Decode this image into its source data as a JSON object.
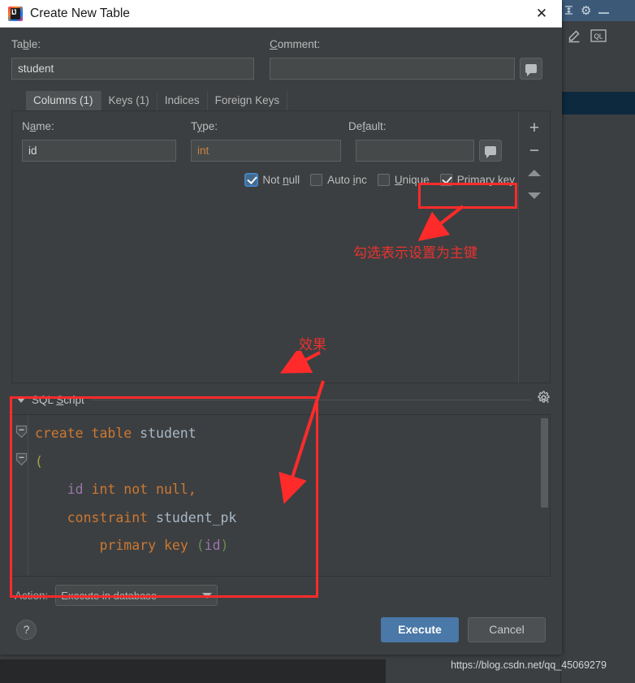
{
  "window": {
    "title": "Create New Table",
    "logo_icon": "intellij-idea-logo",
    "close_icon": "close-icon"
  },
  "form": {
    "table_label": "Table:",
    "table_value": "student",
    "table_placeholder": "",
    "comment_label": "Comment:",
    "comment_value": "",
    "comment_placeholder": "",
    "comment_button_icon": "comment-bubble-icon"
  },
  "tabs": [
    {
      "label": "Columns (1)",
      "active": true
    },
    {
      "label": "Keys (1)",
      "active": false
    },
    {
      "label": "Indices",
      "active": false
    },
    {
      "label": "Foreign Keys",
      "active": false
    }
  ],
  "column_editor": {
    "name_label": "Name:",
    "name_value": "id",
    "type_label": "Type:",
    "type_value": "int",
    "default_label": "Default:",
    "default_value": "",
    "default_button_icon": "comment-bubble-icon",
    "checkboxes": [
      {
        "label": "Not null",
        "checked": true,
        "style": "blue"
      },
      {
        "label": "Auto inc",
        "checked": false,
        "style": "plain"
      },
      {
        "label": "Unique",
        "checked": false,
        "style": "plain"
      },
      {
        "label": "Primary key",
        "checked": true,
        "style": "plain"
      }
    ],
    "side_buttons": [
      {
        "icon": "plus-icon",
        "label": "+"
      },
      {
        "icon": "minus-icon",
        "label": "–"
      },
      {
        "icon": "arrow-up-icon",
        "label": ""
      },
      {
        "icon": "arrow-down-icon",
        "label": ""
      }
    ]
  },
  "sql_script": {
    "title": "SQL Script",
    "collapse_icon": "caret-down-icon",
    "settings_icon": "gear-icon",
    "code_lines": [
      [
        {
          "t": "create table ",
          "c": "kw"
        },
        {
          "t": "student",
          "c": "idn"
        }
      ],
      [
        {
          "t": "(",
          "c": "yel"
        }
      ],
      [
        {
          "t": "    ",
          "c": "idn"
        },
        {
          "t": "id",
          "c": "pur"
        },
        {
          "t": " int not null,",
          "c": "kw"
        }
      ],
      [
        {
          "t": "    ",
          "c": "idn"
        },
        {
          "t": "constraint ",
          "c": "kw"
        },
        {
          "t": "student_pk",
          "c": "idn"
        }
      ],
      [
        {
          "t": "        ",
          "c": "idn"
        },
        {
          "t": "primary key ",
          "c": "kw"
        },
        {
          "t": "(",
          "c": "grn"
        },
        {
          "t": "id",
          "c": "pur"
        },
        {
          "t": ")",
          "c": "grn"
        }
      ]
    ]
  },
  "action": {
    "label": "Action:",
    "value": "Execute in database",
    "dropdown_icon": "chevron-down-icon"
  },
  "footer": {
    "help_label": "?",
    "execute_label": "Execute",
    "cancel_label": "Cancel"
  },
  "annotations": {
    "primary_key_note": "勾选表示设置为主键",
    "effect_note": "效果",
    "color": "#ff2b2b"
  },
  "ide_background": {
    "toolbar_icons": [
      "collapse-all-icon",
      "gear-icon",
      "minimize-icon"
    ],
    "secondary_icons": [
      "pencil-icon",
      "ql-console-icon"
    ],
    "ql_label": "QL"
  },
  "watermark": {
    "text": "https://blog.csdn.net/qq_45069279"
  }
}
